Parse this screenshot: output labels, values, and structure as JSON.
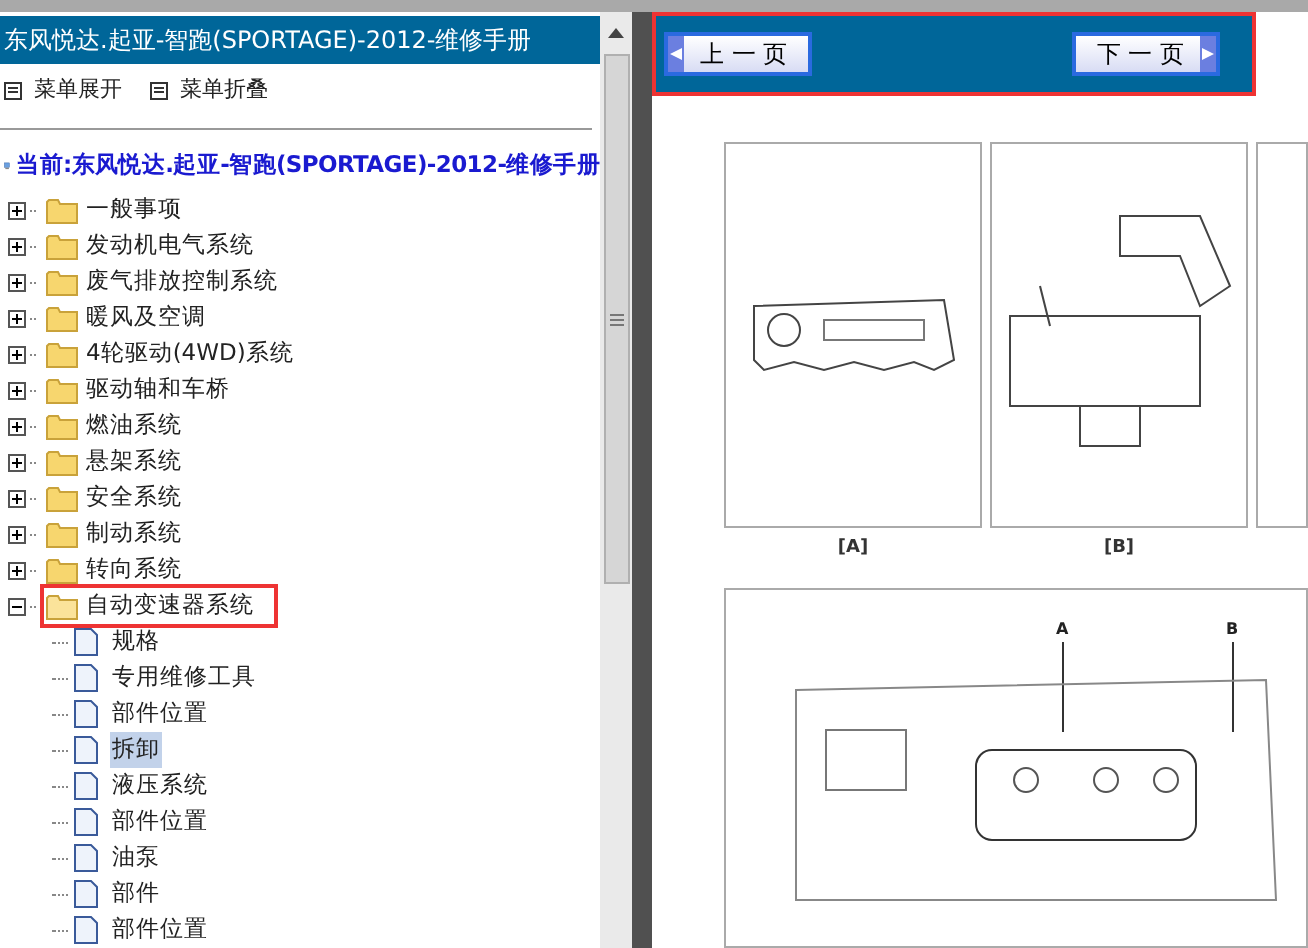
{
  "sidebar": {
    "title": "东风悦达.起亚-智跑(SPORTAGE)-2012-维修手册",
    "menu": [
      {
        "label": "菜单展开"
      },
      {
        "label": "菜单折叠"
      }
    ],
    "current": "当前:东风悦达.起亚-智跑(SPORTAGE)-2012-维修手册",
    "tree": [
      {
        "label": "一般事项",
        "expanded": false,
        "highlighted": false
      },
      {
        "label": "发动机电气系统",
        "expanded": false,
        "highlighted": false
      },
      {
        "label": "废气排放控制系统",
        "expanded": false,
        "highlighted": false
      },
      {
        "label": "暖风及空调",
        "expanded": false,
        "highlighted": false
      },
      {
        "label": "4轮驱动(4WD)系统",
        "expanded": false,
        "highlighted": false
      },
      {
        "label": "驱动轴和车桥",
        "expanded": false,
        "highlighted": false
      },
      {
        "label": "燃油系统",
        "expanded": false,
        "highlighted": false
      },
      {
        "label": "悬架系统",
        "expanded": false,
        "highlighted": false
      },
      {
        "label": "安全系统",
        "expanded": false,
        "highlighted": false
      },
      {
        "label": "制动系统",
        "expanded": false,
        "highlighted": false
      },
      {
        "label": "转向系统",
        "expanded": false,
        "highlighted": false
      },
      {
        "label": "自动变速器系统",
        "expanded": true,
        "highlighted": true,
        "children": [
          {
            "label": "规格",
            "selected": false
          },
          {
            "label": "专用维修工具",
            "selected": false
          },
          {
            "label": "部件位置",
            "selected": false
          },
          {
            "label": "拆卸",
            "selected": true
          },
          {
            "label": "液压系统",
            "selected": false
          },
          {
            "label": "部件位置",
            "selected": false
          },
          {
            "label": "油泵",
            "selected": false
          },
          {
            "label": "部件",
            "selected": false
          },
          {
            "label": "部件位置",
            "selected": false
          }
        ]
      }
    ]
  },
  "viewer": {
    "highlighted": true,
    "prev_button": "上 一 页",
    "next_button": "下 一 页",
    "figures": [
      {
        "caption": "[A]"
      },
      {
        "caption": "[B]"
      }
    ],
    "callouts": [
      "A",
      "B"
    ]
  }
}
